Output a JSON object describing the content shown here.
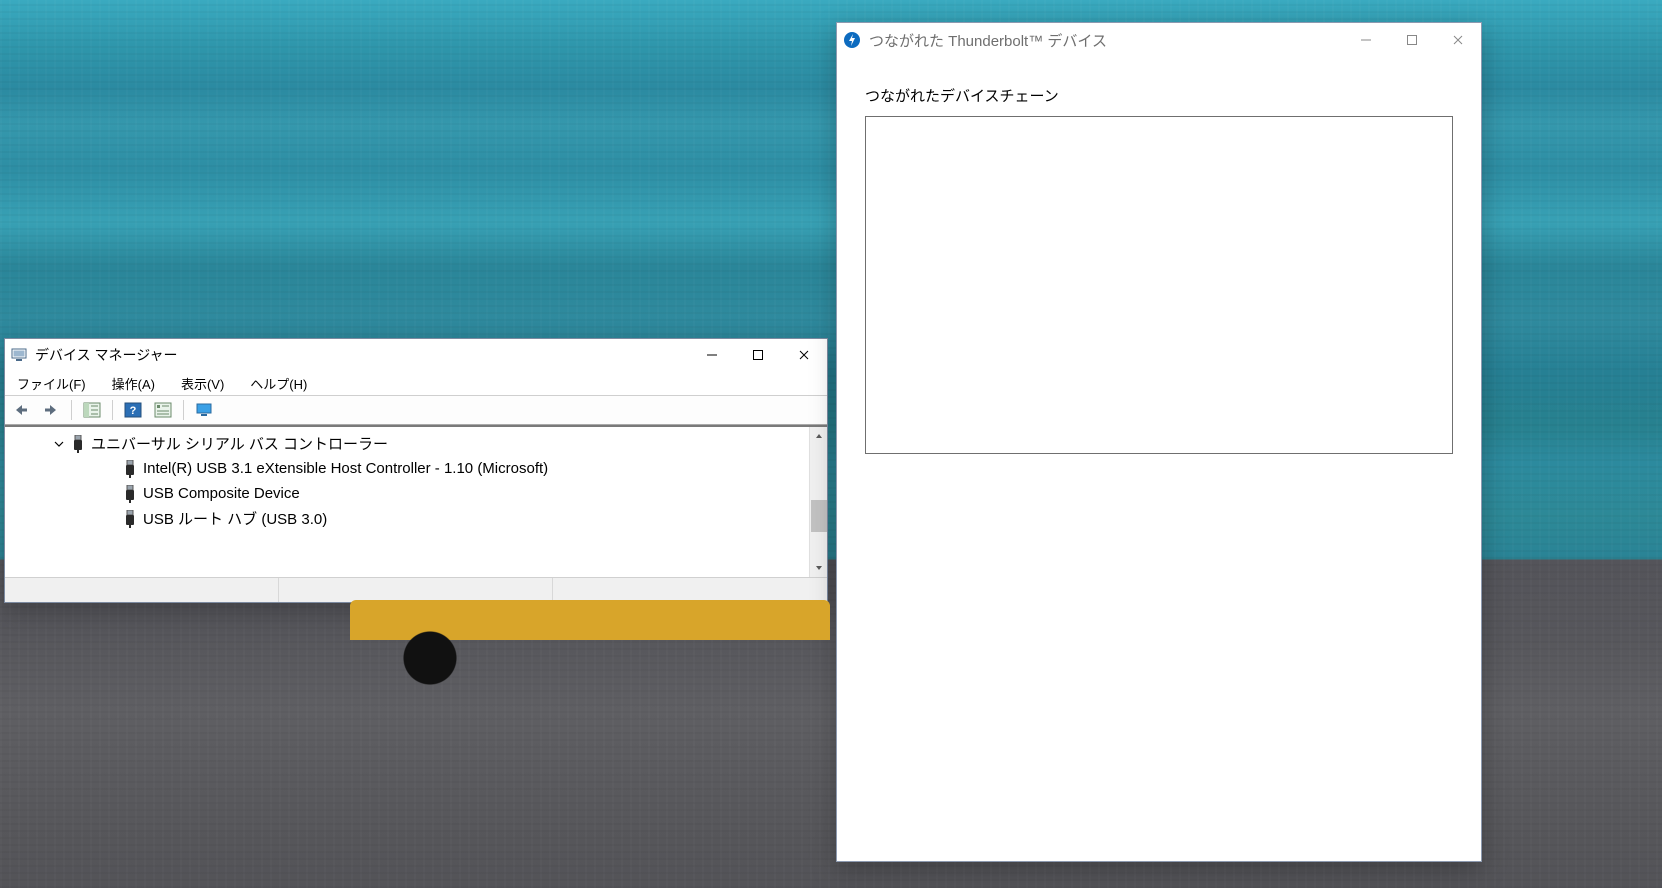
{
  "device_manager": {
    "title": "デバイス マネージャー",
    "menus": {
      "file": "ファイル(F)",
      "action": "操作(A)",
      "view": "表示(V)",
      "help": "ヘルプ(H)"
    },
    "tree": {
      "parent_label": "ユニバーサル シリアル バス コントローラー",
      "children": [
        "Intel(R) USB 3.1 eXtensible Host Controller - 1.10 (Microsoft)",
        "USB Composite Device",
        "USB ルート ハブ (USB 3.0)"
      ]
    }
  },
  "thunderbolt": {
    "title": "つながれた Thunderbolt™ デバイス",
    "heading": "つながれたデバイスチェーン"
  },
  "colors": {
    "window_border": "#7c8aa0",
    "tb_accent": "#0d6bbf"
  }
}
